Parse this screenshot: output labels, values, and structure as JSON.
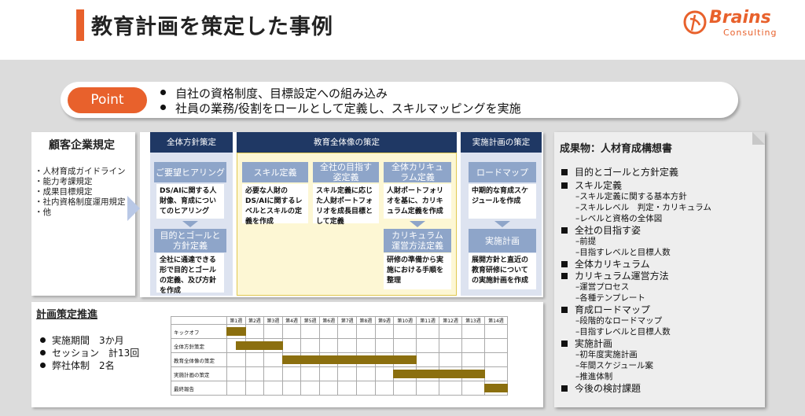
{
  "header": {
    "title": "教育計画を策定した事例",
    "logo_brand": "Brains",
    "logo_sub": "Consulting"
  },
  "point": {
    "label": "Point",
    "lines": [
      "自社の資格制度、目標設定への組み込み",
      "社員の業務/役割をロールとして定義し、スキルマッピングを実施"
    ]
  },
  "customer": {
    "title": "顧客企業規定",
    "items": [
      "・人材育成ガイドライン",
      "・能力考課規定",
      "・成果目標規定",
      "・社内資格制度運用規定",
      "・他"
    ]
  },
  "columns": {
    "c1": {
      "head": "全体方針策定",
      "tab1": "ご要望ヒアリング",
      "card1": "DS/AIに関する人財像、育成についてのヒアリング",
      "tab2": "目的とゴールと方針定義",
      "card2": "全社に通達できる形で目的とゴールの定義、及び方針を作成"
    },
    "c2": {
      "head": "教育全体像の策定",
      "tab1": "スキル定義",
      "card1": "必要な人財のDS/AIに関するレベルとスキルの定義を作成",
      "tab2": "全社の目指す姿定義",
      "card2": "スキル定義に応じた人財ポートフォリオを成長目標として定義",
      "tab3": "全体カリキュラム定義",
      "card3": "人財ポートフォリオを基に、カリキュラム定義を作成",
      "tab4": "カリキュラム運営方法定義",
      "card4": "研修の準備から実施における手順を整理"
    },
    "c3": {
      "head": "実施計画の策定",
      "tab1": "ロードマップ",
      "card1": "中期的な育成スケジュールを作成",
      "tab2": "実施計画",
      "card2": "展開方針と直近の教育研修についての実施計画を作成"
    }
  },
  "result": {
    "title": "成果物：人材育成構想書",
    "sections": [
      {
        "main": "目的とゴールと方針定義",
        "subs": []
      },
      {
        "main": "スキル定義",
        "subs": [
          "–スキル定義に関する基本方針",
          "–スキルレベル　判定・カリキュラム",
          "–レベルと資格の全体図"
        ]
      },
      {
        "main": "全社の目指す姿",
        "subs": [
          "–前提",
          "–目指すレベルと目標人数"
        ]
      },
      {
        "main": "全体カリキュラム",
        "subs": []
      },
      {
        "main": "カリキュラム運営方法",
        "subs": [
          "–運営プロセス",
          "–各種テンプレート"
        ]
      },
      {
        "main": "育成ロードマップ",
        "subs": [
          "–段階的なロードマップ",
          "–目指すレベルと目標人数"
        ]
      },
      {
        "main": "実施計画",
        "subs": [
          "–初年度実施計画",
          "–年間スケジュール案",
          "–推進体制"
        ]
      },
      {
        "main": "今後の検討課題",
        "subs": []
      }
    ]
  },
  "plan": {
    "title": "計画策定推進",
    "items": [
      "実施期間　3か月",
      "セッション　計13回",
      "弊社体制　2名"
    ]
  },
  "gantt": {
    "weeks": [
      "第1週",
      "第2週",
      "第3週",
      "第4週",
      "第5週",
      "第6週",
      "第7週",
      "第8週",
      "第9週",
      "第10週",
      "第11週",
      "第12週",
      "第13週",
      "第14週"
    ],
    "rows": [
      "キックオフ",
      "全体方針策定",
      "教育全体像の策定",
      "実施計画の策定",
      "最終報告"
    ],
    "bar_color": "#8b6f0f"
  },
  "colors": {
    "accent": "#e8612c",
    "navy": "#1f3864",
    "tab_blue": "#8ea5c9"
  }
}
